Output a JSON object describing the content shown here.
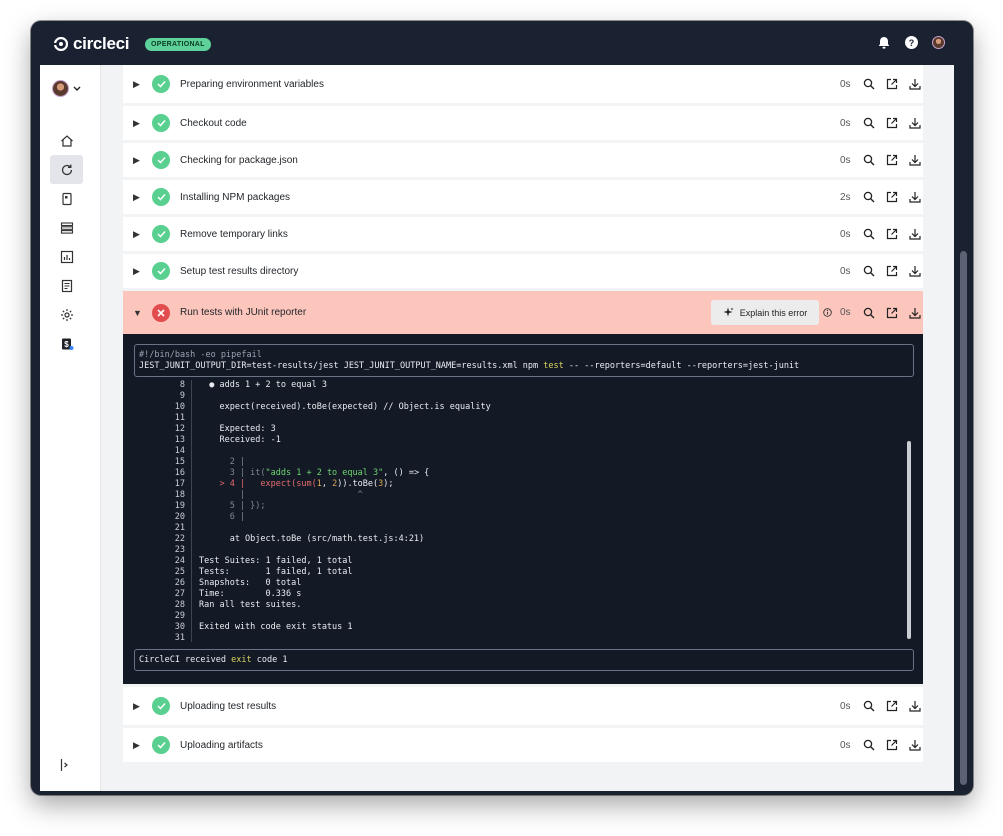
{
  "app": {
    "logo_text": "circleci",
    "status": "OPERATIONAL"
  },
  "colors": {
    "success": "#59d08f",
    "failure": "#e24c4c",
    "failed_row_bg": "#fcc6bd",
    "terminal_bg": "#131a26",
    "nav_bg": "#1a2232"
  },
  "topbar": {
    "icons": [
      "bell-icon",
      "help-icon",
      "avatar"
    ]
  },
  "sidebar": {
    "items": [
      {
        "icon": "home-icon"
      },
      {
        "icon": "pipelines-icon",
        "active": true
      },
      {
        "icon": "projects-icon"
      },
      {
        "icon": "deploys-icon"
      },
      {
        "icon": "insights-icon"
      },
      {
        "icon": "docs-icon"
      },
      {
        "icon": "settings-icon"
      },
      {
        "icon": "plan-icon"
      }
    ]
  },
  "steps_before": [
    {
      "name": "Preparing environment variables",
      "duration": "0s"
    },
    {
      "name": "Checkout code",
      "duration": "0s"
    },
    {
      "name": "Checking for package.json",
      "duration": "0s"
    },
    {
      "name": "Installing NPM packages",
      "duration": "2s"
    },
    {
      "name": "Remove temporary links",
      "duration": "0s"
    },
    {
      "name": "Setup test results directory",
      "duration": "0s"
    }
  ],
  "failed_step": {
    "name": "Run tests with JUnit reporter",
    "duration": "0s",
    "explain_label": "Explain this error",
    "command_line1": "#!/bin/bash -eo pipefail",
    "command_line2_pre": "JEST_JUNIT_OUTPUT_DIR=test-results/jest JEST_JUNIT_OUTPUT_NAME=results.xml npm ",
    "command_line2_hl": "test",
    "command_line2_post": " -- --reporters=default --reporters=jest-junit",
    "output_lines": [
      {
        "n": "8",
        "t": "  ● adds 1 + 2 to equal 3"
      },
      {
        "n": "9",
        "t": ""
      },
      {
        "n": "10",
        "t": "    expect(received).toBe(expected) // Object.is equality"
      },
      {
        "n": "11",
        "t": ""
      },
      {
        "n": "12",
        "t": "    Expected: 3"
      },
      {
        "n": "13",
        "t": "    Received: -1"
      },
      {
        "n": "14",
        "t": ""
      },
      {
        "n": "15",
        "t": ""
      },
      {
        "n": "16",
        "t": ""
      },
      {
        "n": "17",
        "t": ""
      },
      {
        "n": "18",
        "t": ""
      },
      {
        "n": "19",
        "t": ""
      },
      {
        "n": "20",
        "t": ""
      },
      {
        "n": "21",
        "t": ""
      },
      {
        "n": "22",
        "t": "      at Object.toBe (src/math.test.js:4:21)"
      },
      {
        "n": "23",
        "t": ""
      },
      {
        "n": "24",
        "t": "Test Suites: 1 failed, 1 total"
      },
      {
        "n": "25",
        "t": "Tests:       1 failed, 1 total"
      },
      {
        "n": "26",
        "t": "Snapshots:   0 total"
      },
      {
        "n": "27",
        "t": "Time:        0.336 s"
      },
      {
        "n": "28",
        "t": "Ran all test suites."
      },
      {
        "n": "29",
        "t": ""
      },
      {
        "n": "30",
        "t": "Exited with code exit status 1"
      },
      {
        "n": "31",
        "t": ""
      }
    ],
    "code_frame": {
      "l2": "      2 |",
      "l3_pre": "      3 | it(",
      "l3_str": "\"adds 1 + 2 to equal 3\"",
      "l3_post": ", () => {",
      "l4_marker": "    > 4 |   expect(sum(",
      "l4_n1": "1",
      "l4_mid": ", ",
      "l4_n2": "2",
      "l4_post": ")).toBe(",
      "l4_n3": "3",
      "l4_end": ");",
      "l_caret": "        |                      ^",
      "l5": "      5 | });",
      "l6": "      6 |"
    },
    "exit_pre": "CircleCI received ",
    "exit_hl": "exit",
    "exit_post": " code 1"
  },
  "steps_after": [
    {
      "name": "Uploading test results",
      "duration": "0s"
    },
    {
      "name": "Uploading artifacts",
      "duration": "0s"
    }
  ]
}
